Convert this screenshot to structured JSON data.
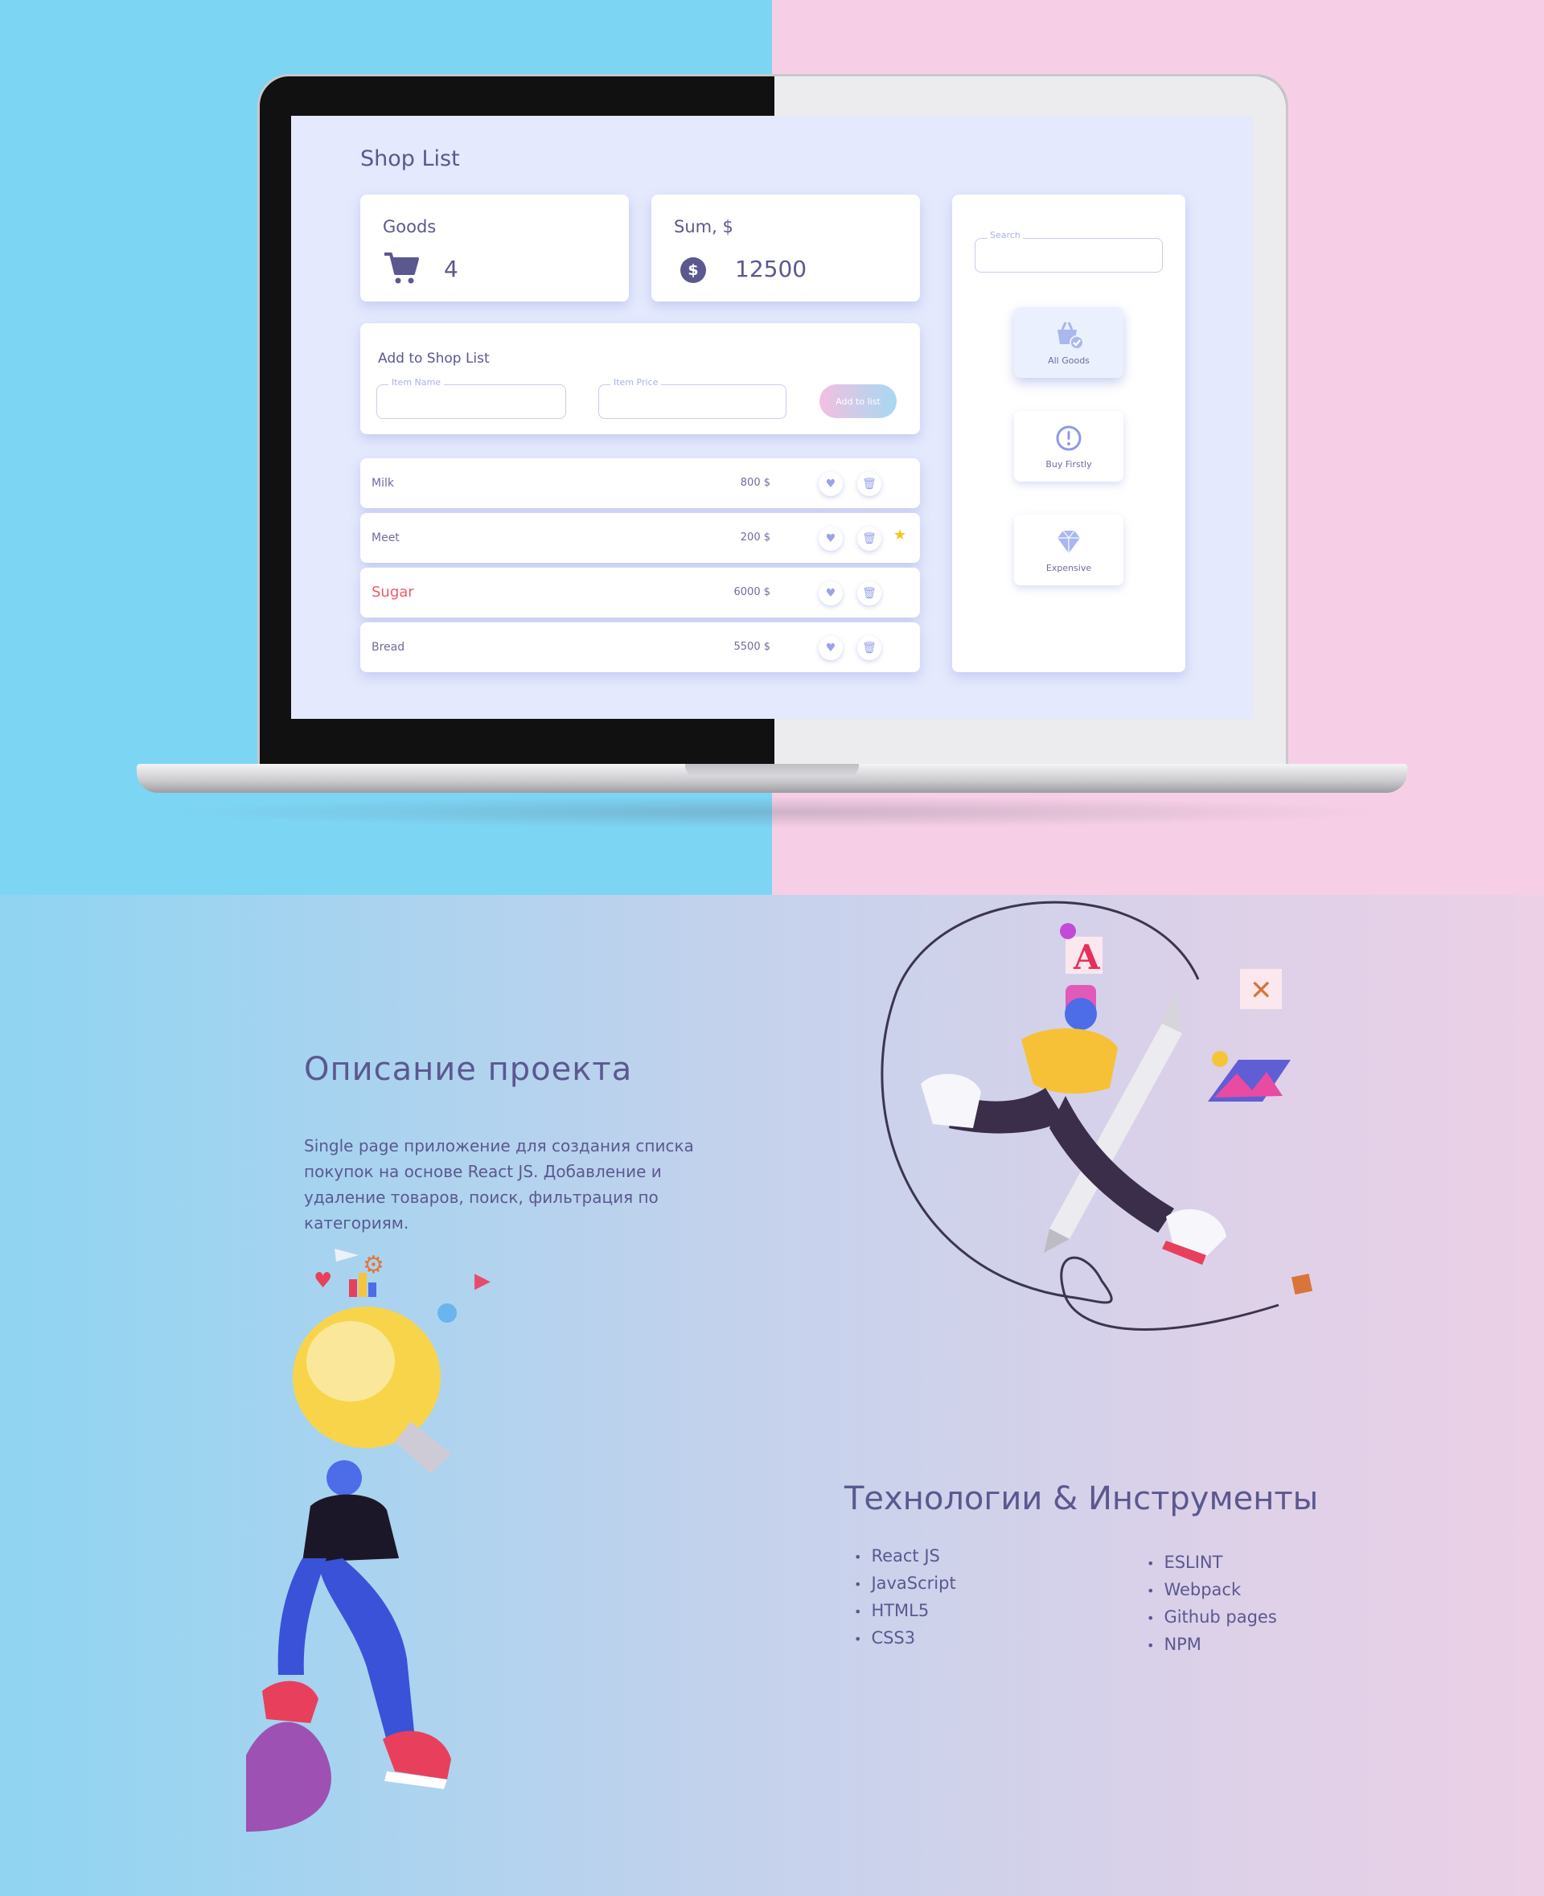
{
  "app": {
    "title": "Shop List",
    "goods": {
      "label": "Goods",
      "value": "4",
      "icon": "cart-icon"
    },
    "sum": {
      "label": "Sum, $",
      "value": "12500",
      "icon": "dollar-icon",
      "symbol": "$"
    },
    "add_form": {
      "title": "Add to Shop List",
      "item_name_placeholder": "Item Name",
      "item_price_placeholder": "Item Price",
      "button_label": "Add to list"
    },
    "items": [
      {
        "name": "Milk",
        "price": "800 $",
        "highlight": false,
        "starred": false
      },
      {
        "name": "Meet",
        "price": "200 $",
        "highlight": false,
        "starred": true
      },
      {
        "name": "Sugar",
        "price": "6000 $",
        "highlight": true,
        "starred": false
      },
      {
        "name": "Bread",
        "price": "5500 $",
        "highlight": false,
        "starred": false
      }
    ],
    "search": {
      "placeholder": "Search"
    },
    "filters": [
      {
        "label": "All Goods",
        "icon": "basket-check-icon",
        "active": true
      },
      {
        "label": "Buy Firstly",
        "icon": "exclamation-icon",
        "active": false
      },
      {
        "label": "Expensive",
        "icon": "diamond-icon",
        "active": false
      }
    ],
    "colors": {
      "accent": "#5b5890",
      "screen_bg": "#e4e9fd",
      "highlight": "#ee5a6a",
      "star": "#f5c518"
    }
  },
  "description": {
    "title": "Описание проекта",
    "text": "Single page приложение  для создания списка покупок на основе React JS. Добавление и удаление товаров, поиск, фильтрация по категориям."
  },
  "technologies": {
    "title": "Технологии & Инструменты",
    "left": [
      "React JS",
      "JavaScript",
      "HTML5",
      "CSS3"
    ],
    "right": [
      "ESLINT",
      "Webpack",
      "Github pages",
      "NPM"
    ]
  }
}
